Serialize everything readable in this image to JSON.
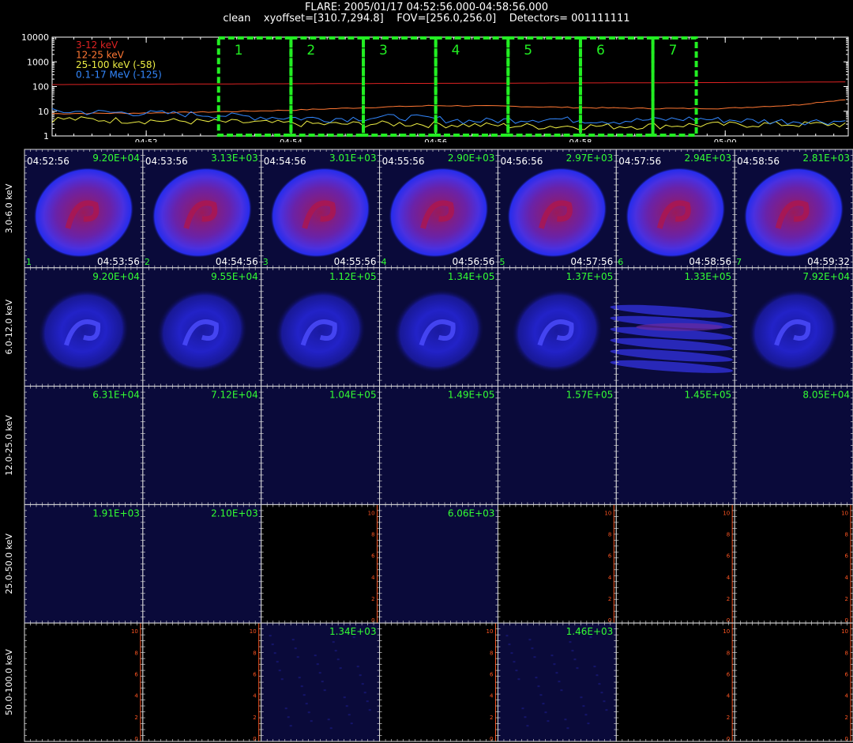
{
  "header": {
    "line1": "FLARE: 2005/01/17 04:52:56.000-04:58:56.000",
    "line2": "clean    xyoffset=[310.7,294.8]    FOV=[256.0,256.0]    Detectors= 001111111"
  },
  "colors": {
    "energy_3_12": "#dd2222",
    "energy_12_25": "#ff7733",
    "energy_25_100": "#eeee44",
    "energy_01_17": "#3388ff",
    "interval_box": "#22ee22",
    "tick_color": "#ff5522",
    "label_green": "#33ff33"
  },
  "chart_data": [
    {
      "type": "line",
      "yscale": "log",
      "ylim": [
        1,
        10000
      ],
      "y_ticks": [
        "10000",
        "1000",
        "100",
        "10",
        "1"
      ],
      "x_ticks": [
        "04:52",
        "04:54",
        "04:56",
        "04:58",
        "05:00"
      ],
      "x_tick_minutes": [
        52,
        54,
        56,
        58,
        60
      ],
      "xlim_minutes": [
        50.7,
        61.7
      ],
      "series": [
        {
          "name": "3-12 keV",
          "color": "#dd2222",
          "x": [
            50.7,
            52,
            54,
            56,
            58,
            60,
            61.7
          ],
          "values": [
            120,
            125,
            130,
            135,
            140,
            145,
            155
          ]
        },
        {
          "name": "12-25 keV",
          "color": "#ff7733",
          "x": [
            50.7,
            52,
            53,
            54,
            55,
            56,
            57,
            58,
            59,
            60,
            61,
            61.7
          ],
          "values": [
            8,
            8.5,
            9.5,
            11,
            14,
            17,
            16,
            14,
            13,
            13,
            18,
            30
          ]
        },
        {
          "name": "25-100 keV (-58)",
          "color": "#eeee44",
          "x": [
            50.7,
            51.5,
            52.5,
            53.5,
            54.5,
            55.5,
            56.5,
            57.5,
            58.5,
            59.5,
            60.5,
            61.7
          ],
          "values": [
            5,
            4.5,
            4,
            3.5,
            3,
            3.2,
            2.8,
            2.5,
            2.5,
            2.8,
            3,
            3
          ]
        },
        {
          "name": "0.1-17 MeV (-125)",
          "color": "#3388ff",
          "x": [
            50.7,
            51.5,
            52.5,
            53.5,
            54.5,
            55.5,
            56.5,
            57.5,
            58.5,
            59.5,
            60.5,
            61.7
          ],
          "values": [
            10,
            9,
            8,
            6,
            5,
            6,
            4,
            5,
            4,
            5,
            4,
            4
          ]
        }
      ],
      "intervals": [
        {
          "label": "1",
          "start": 53.0,
          "end": 54.0
        },
        {
          "label": "2",
          "start": 54.0,
          "end": 55.0
        },
        {
          "label": "3",
          "start": 55.0,
          "end": 56.0
        },
        {
          "label": "4",
          "start": 56.0,
          "end": 57.0
        },
        {
          "label": "5",
          "start": 57.0,
          "end": 58.0
        },
        {
          "label": "6",
          "start": 58.0,
          "end": 59.0
        },
        {
          "label": "7",
          "start": 59.0,
          "end": 59.6
        }
      ]
    },
    {
      "type": "heatmap",
      "energy_bands": [
        "3.0-6.0 keV",
        "6.0-12.0 keV",
        "12.0-25.0 keV",
        "25.0-50.0 keV",
        "50.0-100.0 keV"
      ],
      "columns": [
        {
          "index": "1",
          "start": "04:52:56",
          "end": "04:53:56"
        },
        {
          "index": "2",
          "start": "04:53:56",
          "end": "04:54:56"
        },
        {
          "index": "3",
          "start": "04:54:56",
          "end": "04:55:56"
        },
        {
          "index": "4",
          "start": "04:55:56",
          "end": "04:56:56"
        },
        {
          "index": "5",
          "start": "04:56:56",
          "end": "04:57:56"
        },
        {
          "index": "6",
          "start": "04:57:56",
          "end": "04:58:56"
        },
        {
          "index": "7",
          "start": "04:58:56",
          "end": "04:59:32"
        }
      ],
      "peak_values": [
        [
          "9.20E+04",
          "3.13E+03",
          "3.01E+03",
          "2.90E+03",
          "2.97E+03",
          "2.94E+03",
          "2.81E+03"
        ],
        [
          "9.20E+04",
          "9.55E+04",
          "1.12E+05",
          "1.34E+05",
          "1.37E+05",
          "1.33E+05",
          "7.92E+04"
        ],
        [
          "6.31E+04",
          "7.12E+04",
          "1.04E+05",
          "1.49E+05",
          "1.57E+05",
          "1.45E+05",
          "8.05E+04"
        ],
        [
          "1.91E+03",
          "2.10E+03",
          "",
          "6.06E+03",
          "",
          "",
          ""
        ],
        [
          "",
          "",
          "1.34E+03",
          "",
          "1.46E+03",
          "",
          ""
        ]
      ],
      "cell_kind": [
        [
          "red-blob",
          "red-blob",
          "red-blob",
          "red-blob",
          "red-blob",
          "red-blob",
          "red-blob"
        ],
        [
          "blue-ring",
          "blue-ring",
          "blue-ring",
          "blue-ring",
          "blue-ring",
          "streak",
          "blue-ring"
        ],
        [
          "navy",
          "navy",
          "navy",
          "navy",
          "navy",
          "navy",
          "navy"
        ],
        [
          "navy",
          "navy",
          "black-axes",
          "navy",
          "black-axes",
          "black-axes",
          "black-axes"
        ],
        [
          "black-axes",
          "black-axes",
          "speckle",
          "black-axes",
          "speckle",
          "black-axes",
          "black-axes"
        ]
      ],
      "axis_ticks": [
        "0",
        "2",
        "4",
        "6",
        "8",
        "10"
      ]
    }
  ]
}
